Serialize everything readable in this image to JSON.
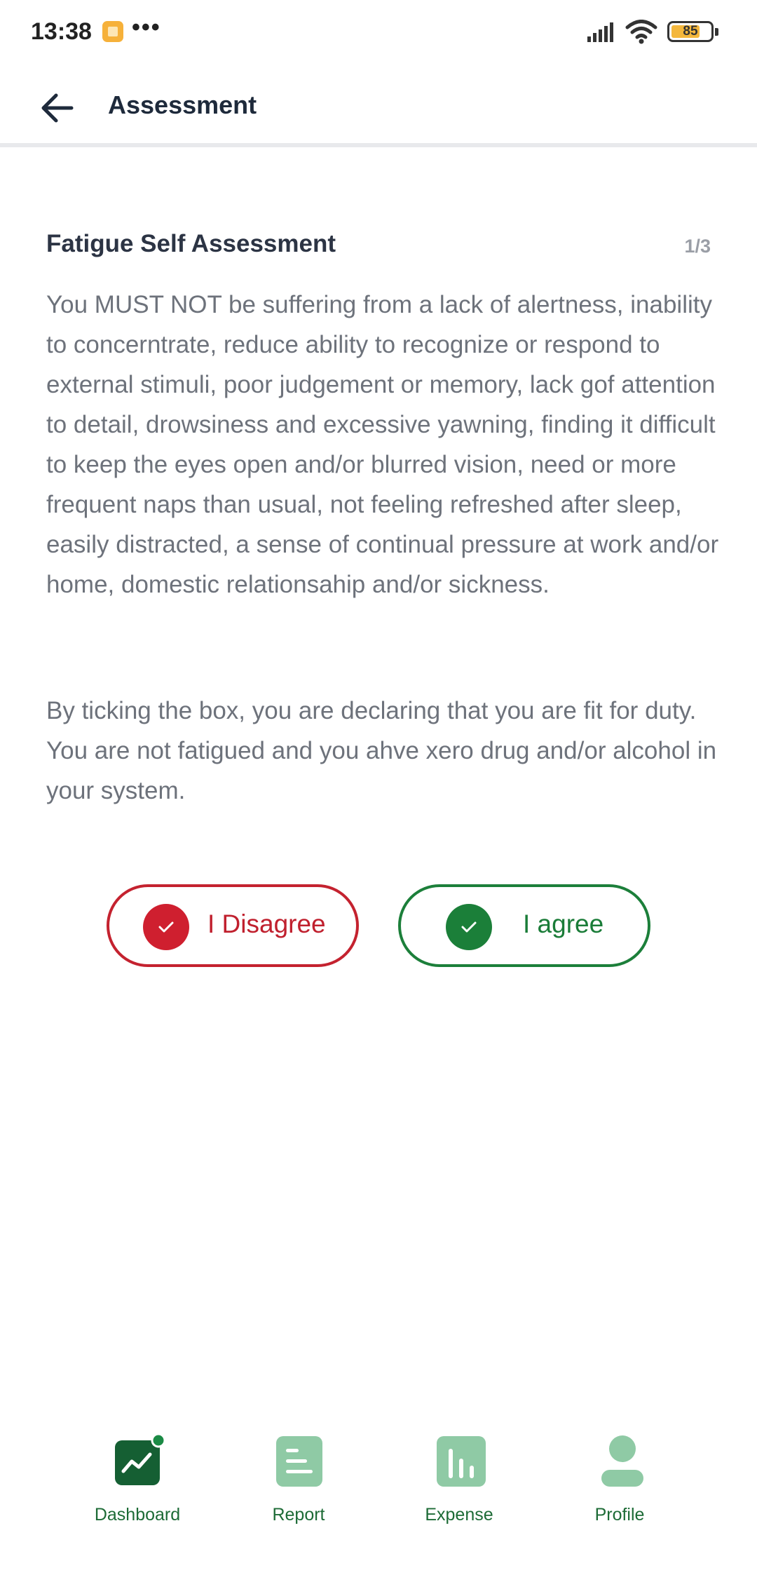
{
  "status_bar": {
    "time": "13:38",
    "dots": "•••",
    "battery": "85"
  },
  "header": {
    "title": "Assessment"
  },
  "assessment": {
    "title": "Fatigue Self Assessment",
    "page": "1/3",
    "paragraph_1": "You MUST NOT be suffering from a lack of alertness, inability to concerntrate, reduce ability to recognize or respond to external stimuli, poor judgement or memory, lack gof attention to detail, drowsiness and excessive yawning, finding it difficult to keep the eyes open and/or blurred vision, need or more frequent naps than usual, not feeling refreshed after sleep, easily distracted, a sense of continual pressure at work and/or home, domestic relationsahip and/or sickness.",
    "paragraph_2": "By ticking the box, you are declaring that you are fit for duty. You are not fatigued and you ahve xero drug and/or alcohol in your system."
  },
  "actions": {
    "disagree_label": "I Disagree",
    "agree_label": "I agree",
    "disagree_color": "#c4222f",
    "agree_color": "#1c7f3a"
  },
  "nav": {
    "items": [
      {
        "label": "Dashboard",
        "icon": "dashboard-chart-icon",
        "active": true
      },
      {
        "label": "Report",
        "icon": "report-icon",
        "active": false
      },
      {
        "label": "Expense",
        "icon": "expense-bar-chart-icon",
        "active": false
      },
      {
        "label": "Profile",
        "icon": "profile-person-icon",
        "active": false
      }
    ]
  }
}
